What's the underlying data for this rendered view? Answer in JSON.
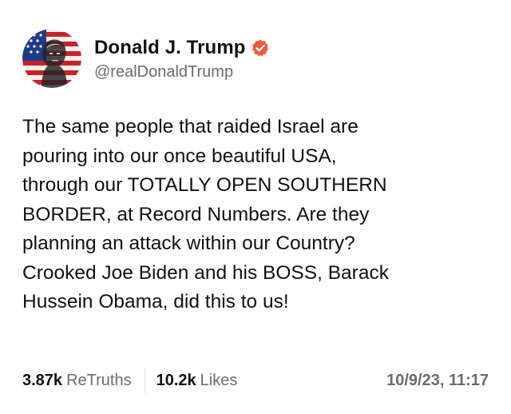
{
  "post": {
    "author": {
      "display_name": "Donald J. Trump",
      "handle": "@realDonaldTrump",
      "verified": true,
      "verified_color": "#ef5a3c"
    },
    "text": "The same people that raided Israel are\npouring into our once beautiful USA,\nthrough our TOTALLY OPEN SOUTHERN\nBORDER, at Record Numbers. Are they\nplanning an attack within our Country?\nCrooked Joe Biden and his BOSS, Barack\nHussein Obama, did this to us!",
    "stats": {
      "retruths_count": "3.87k",
      "retruths_label": "ReTruths",
      "likes_count": "10.2k",
      "likes_label": "Likes"
    },
    "timestamp": "10/9/23, 11:17"
  },
  "colors": {
    "text_primary": "#111111",
    "text_secondary": "#6b6b70",
    "divider": "#e2e2e6",
    "avatar_red": "#c8232c",
    "avatar_blue": "#1f3c88"
  },
  "icons": {
    "avatar": "flag-portrait-avatar",
    "verified": "verified-badge-icon"
  }
}
